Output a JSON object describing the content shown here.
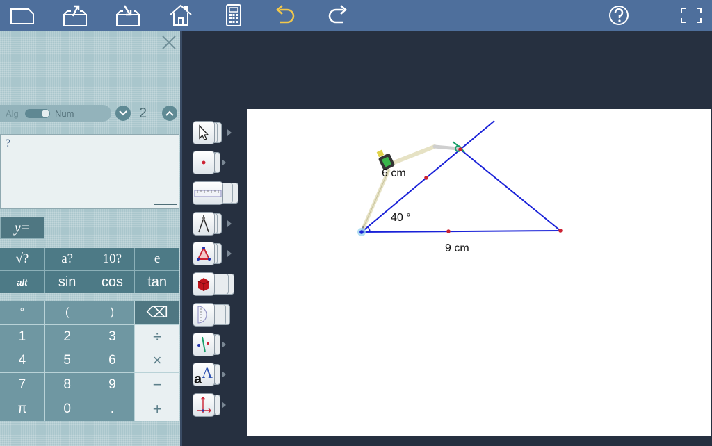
{
  "mode": {
    "alg_label": "Alg",
    "num_label": "Num",
    "digits": "2"
  },
  "expression": {
    "placeholder": "?"
  },
  "function_button": {
    "label": "y="
  },
  "function_keys": [
    {
      "name": "sqrt-key",
      "label": "√?"
    },
    {
      "name": "power-key",
      "label": "a?"
    },
    {
      "name": "ten-power-key",
      "label": "10?"
    },
    {
      "name": "e-key",
      "label": "e"
    },
    {
      "name": "alt-key",
      "label": "alt"
    },
    {
      "name": "sin-key",
      "label": "sin"
    },
    {
      "name": "cos-key",
      "label": "cos"
    },
    {
      "name": "tan-key",
      "label": "tan"
    }
  ],
  "number_keys": [
    "°",
    "(",
    ")",
    "⌫",
    "1",
    "2",
    "3",
    "÷",
    "4",
    "5",
    "6",
    "×",
    "7",
    "8",
    "9",
    "−",
    "π",
    "0",
    ".",
    "+"
  ],
  "canvas": {
    "side_a_label": "6 cm",
    "angle_label": "40 °",
    "side_b_label": "9 cm"
  },
  "colors": {
    "topbar": "#4e6f9c",
    "accent_undo": "#f2c84b",
    "triangle": "#1a22d8",
    "points": "#cc2233",
    "compass_arc": "#1aa06b"
  },
  "tools": [
    "select-arrow-icon",
    "point-icon",
    "ruler-icon",
    "compass-icon",
    "triangle-icon",
    "solid-cube-icon",
    "protractor-icon",
    "parallel-line-icon",
    "text-icon",
    "axes-icon"
  ]
}
